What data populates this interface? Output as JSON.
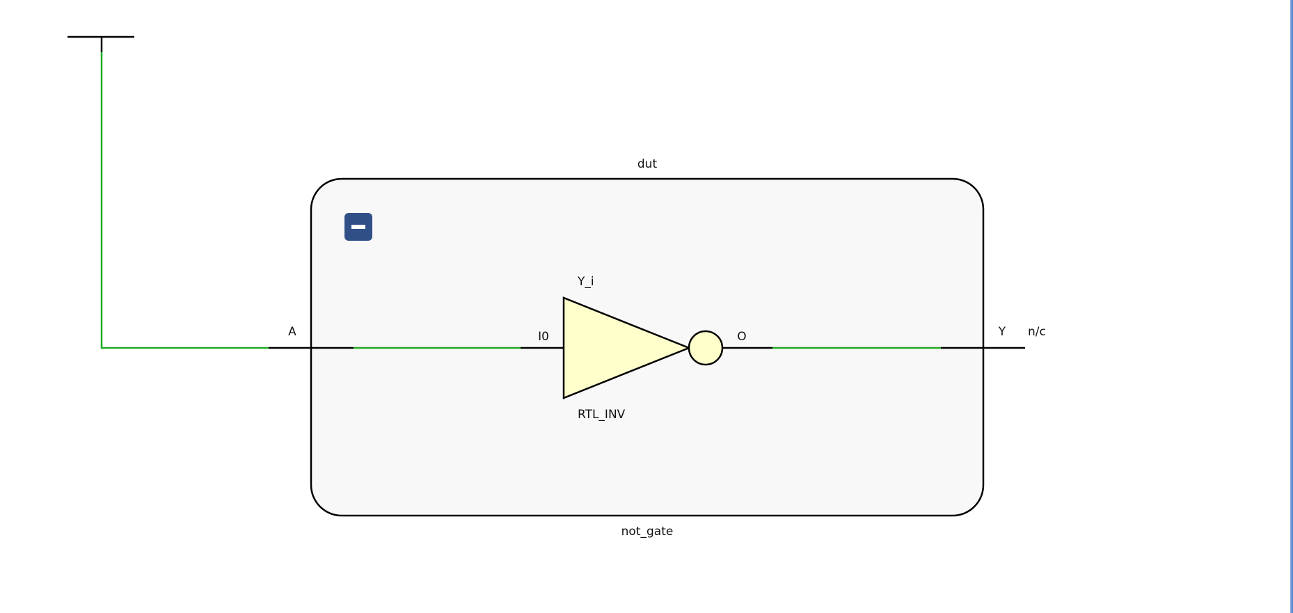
{
  "schematic": {
    "cell": {
      "instance_name": "dut",
      "type_name": "not_gate",
      "collapse_button_symbol": "−"
    },
    "ports": {
      "input": "A",
      "output": "Y",
      "output_status": "n/c"
    },
    "gate": {
      "instance_name": "Y_i",
      "type_name": "RTL_INV",
      "input_pin": "I0",
      "output_pin": "O"
    }
  },
  "colors": {
    "net_active": "#22aa22",
    "net_default": "#000000",
    "cell_fill": "#f8f8f8",
    "gate_fill": "#ffffcc",
    "button_fill": "#2f4f86",
    "window_edge": "#4a7fc8"
  },
  "icons": {
    "collapse": "minus-icon",
    "source": "tee-source-icon"
  }
}
